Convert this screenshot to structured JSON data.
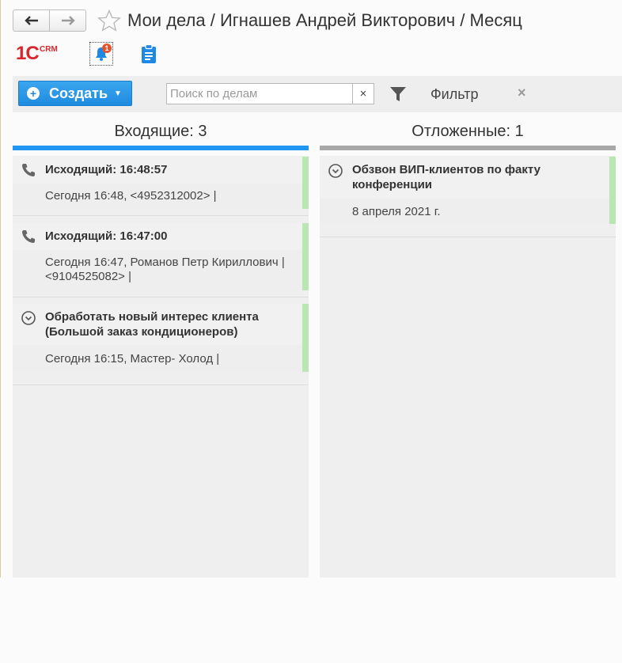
{
  "window": {
    "title": "Мои дела / Игнашев Андрей Викторович / Месяц",
    "back_icon": "arrow-left",
    "forward_icon": "arrow-right",
    "favorite_icon": "star-outline"
  },
  "icons": {
    "logo_main": "1С",
    "logo_sub": "CRM",
    "notification_count": "1",
    "clipboard_icon": "clipboard"
  },
  "toolbar": {
    "create_label": "Создать",
    "search_placeholder": "Поиск по делам",
    "search_value": "",
    "search_clear": "×",
    "filter_label": "Фильтр",
    "filter_clear": "×"
  },
  "columns": {
    "incoming": {
      "header": "Входящие: 3",
      "cards": [
        {
          "icon": "phone",
          "title": "Исходящий: 16:48:57",
          "subtitle": "Сегодня 16:48,  <4952312002> |"
        },
        {
          "icon": "phone",
          "title": "Исходящий: 16:47:00",
          "subtitle": "Сегодня 16:47, Романов Петр Кириллович |  <9104525082> |"
        },
        {
          "icon": "circle-chevron-down",
          "title": "Обработать новый интерес клиента (Большой заказ кондиционеров)",
          "subtitle": "Сегодня 16:15, Мастер- Холод |"
        }
      ]
    },
    "postponed": {
      "header": "Отложенные: 1",
      "cards": [
        {
          "icon": "circle-chevron-down",
          "title": "Обзвон ВИП-клиентов по факту конференции",
          "subtitle": "8 апреля 2021 г."
        }
      ]
    }
  },
  "colors": {
    "accent_blue": "#2196f3",
    "create_button": "#1f8be0",
    "status_stripe": "#b9e6b3",
    "badge": "#e5512a",
    "logo_red": "#d7262c"
  }
}
